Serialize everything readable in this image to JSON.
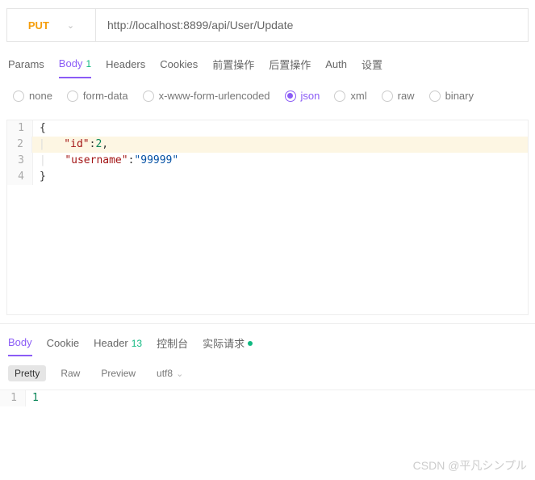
{
  "request": {
    "method": "PUT",
    "url": "http://localhost:8899/api/User/Update"
  },
  "tabs": {
    "params": "Params",
    "body": "Body",
    "body_badge": "1",
    "headers": "Headers",
    "cookies": "Cookies",
    "pre": "前置操作",
    "post": "后置操作",
    "auth": "Auth",
    "settings": "设置"
  },
  "body_types": {
    "none": "none",
    "formdata": "form-data",
    "urlencoded": "x-www-form-urlencoded",
    "json": "json",
    "xml": "xml",
    "raw": "raw",
    "binary": "binary"
  },
  "editor": {
    "l1_n": "1",
    "l1": "{",
    "l2_n": "2",
    "l2_k": "\"id\"",
    "l2_v": "2",
    "l2_p": ":",
    "l2_c": ",",
    "l3_n": "3",
    "l3_k": "\"username\"",
    "l3_p": ":",
    "l3_v": "\"99999\"",
    "l4_n": "4",
    "l4": "}"
  },
  "response_tabs": {
    "body": "Body",
    "cookie": "Cookie",
    "header": "Header",
    "header_badge": "13",
    "console": "控制台",
    "actual": "实际请求"
  },
  "response_toolbar": {
    "pretty": "Pretty",
    "raw": "Raw",
    "preview": "Preview",
    "encoding": "utf8"
  },
  "response_editor": {
    "l1_n": "1",
    "l1": "1"
  },
  "watermark": "CSDN @平凡シンプル"
}
